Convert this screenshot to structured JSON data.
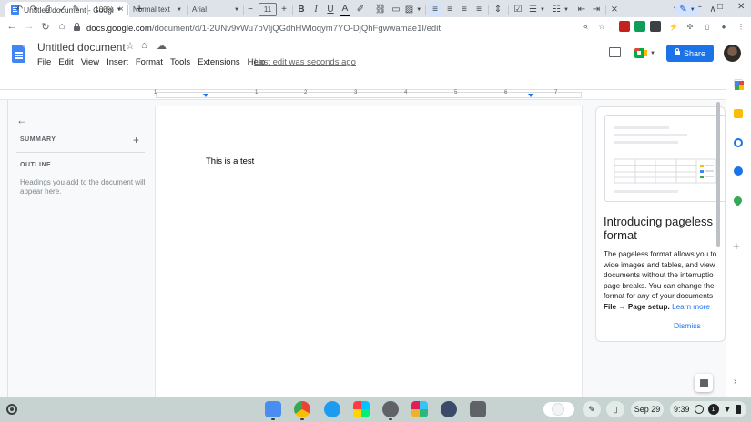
{
  "browser": {
    "tab_title": "Untitled document - Google Docs",
    "tab_close": "×",
    "new_tab": "+",
    "url_host": "docs.google.com",
    "url_path": "/document/d/1-2UNv9vWu7bVljQGdhHWloqym7YO-DjQhFgwwamae1I/edit"
  },
  "docs": {
    "title": "Untitled document",
    "menu": [
      "File",
      "Edit",
      "View",
      "Insert",
      "Format",
      "Tools",
      "Extensions",
      "Help"
    ],
    "last_edit": "Last edit was seconds ago",
    "share_label": "Share"
  },
  "toolbar": {
    "zoom": "100%",
    "style": "Normal text",
    "font": "Arial",
    "font_size": "11",
    "minus": "−",
    "plus": "+"
  },
  "ruler": [
    "1",
    "1",
    "2",
    "3",
    "4",
    "5",
    "6",
    "7"
  ],
  "outline": {
    "summary_label": "SUMMARY",
    "outline_label": "OUTLINE",
    "hint": "Headings you add to the document will appear here."
  },
  "document": {
    "body_text": "This is a test"
  },
  "promo": {
    "title": "Introducing pageless format",
    "body": "The pageless format allows you to wide images and tables, and view documents without the interruptio page breaks. You can change the format for any of your documents",
    "path_text": "File → Page setup.",
    "learn_more": "Learn more",
    "dismiss": "Dismiss"
  },
  "shelf": {
    "date": "Sep 29",
    "time": "9:39",
    "notification_count": "1"
  },
  "colors": {
    "accent": "#1a73e8",
    "docs_blue": "#4285f4",
    "shelf_bg": "#c7d3d0"
  }
}
